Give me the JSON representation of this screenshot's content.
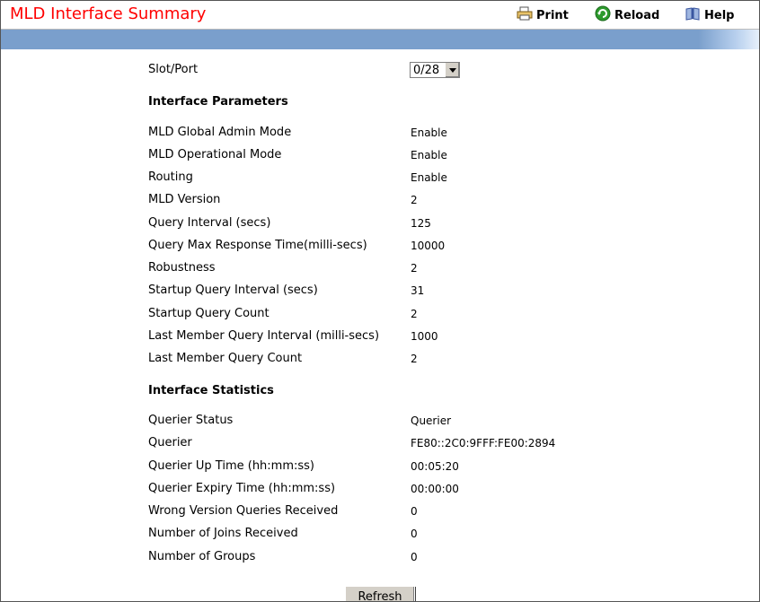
{
  "header": {
    "title": "MLD Interface Summary",
    "print_label": "Print",
    "reload_label": "Reload",
    "help_label": "Help"
  },
  "slot_port": {
    "label": "Slot/Port",
    "selected": "0/28"
  },
  "interface_parameters": {
    "heading": "Interface Parameters",
    "rows": [
      {
        "label": "MLD Global Admin Mode",
        "value": "Enable"
      },
      {
        "label": "MLD Operational Mode",
        "value": "Enable"
      },
      {
        "label": "Routing",
        "value": "Enable"
      },
      {
        "label": "MLD Version",
        "value": "2"
      },
      {
        "label": "Query Interval (secs)",
        "value": "125"
      },
      {
        "label": "Query Max Response Time(milli-secs)",
        "value": "10000"
      },
      {
        "label": "Robustness",
        "value": "2"
      },
      {
        "label": "Startup Query Interval (secs)",
        "value": "31"
      },
      {
        "label": "Startup Query Count",
        "value": "2"
      },
      {
        "label": "Last Member Query Interval (milli-secs)",
        "value": "1000"
      },
      {
        "label": "Last Member Query Count",
        "value": "2"
      }
    ]
  },
  "interface_statistics": {
    "heading": "Interface Statistics",
    "rows": [
      {
        "label": "Querier Status",
        "value": "Querier"
      },
      {
        "label": "Querier",
        "value": "FE80::2C0:9FFF:FE00:2894"
      },
      {
        "label": "Querier Up Time (hh:mm:ss)",
        "value": "00:05:20"
      },
      {
        "label": "Querier Expiry Time (hh:mm:ss)",
        "value": "00:00:00"
      },
      {
        "label": "Wrong Version Queries Received",
        "value": "0"
      },
      {
        "label": "Number of Joins Received",
        "value": "0"
      },
      {
        "label": "Number of Groups",
        "value": "0"
      }
    ]
  },
  "refresh_label": "Refresh",
  "colors": {
    "title": "#ff0000",
    "band": "#7a9fcc"
  },
  "icons": {
    "print": "printer-icon",
    "reload": "reload-icon",
    "help": "help-book-icon",
    "dropdown": "chevron-down-icon"
  }
}
